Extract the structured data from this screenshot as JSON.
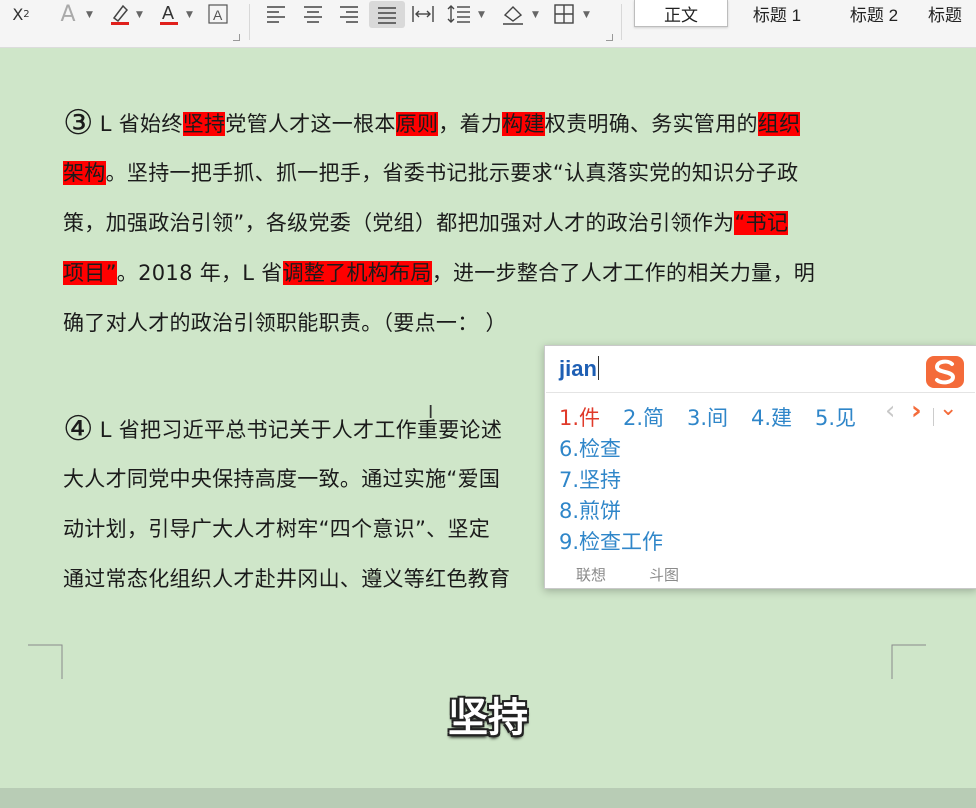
{
  "toolbar": {
    "icons": [
      "subscript-icon",
      "text-effect-icon",
      "highlight-icon",
      "font-color-icon",
      "char-border-icon",
      "align-left-icon",
      "align-center-icon",
      "align-right-icon",
      "justify-icon",
      "distributed-icon",
      "line-spacing-icon",
      "shading-icon",
      "borders-icon"
    ],
    "styles": [
      "正文",
      "标题 1",
      "标题 2",
      "标题"
    ]
  },
  "document": {
    "para3": {
      "marker": "③",
      "lines": [
        [
          {
            "t": "L 省始终"
          },
          {
            "t": "坚持",
            "hl": true
          },
          {
            "t": "党管人才这一根本"
          },
          {
            "t": "原则",
            "hl": true
          },
          {
            "t": "，着力"
          },
          {
            "t": "构建",
            "hl": true
          },
          {
            "t": "权责明确、务实管用的"
          },
          {
            "t": "组织",
            "hl": true
          }
        ],
        [
          {
            "t": "架构",
            "hl": true
          },
          {
            "t": "。坚持一把手抓、抓一把手，省委书记批示要求“认真落实党的知识分子政"
          }
        ],
        [
          {
            "t": "策，加强政治引领”，各级党委（党组）都把加强对人才的政治引领作为"
          },
          {
            "t": "“书记",
            "hl": true
          }
        ],
        [
          {
            "t": "项目”",
            "hl": true
          },
          {
            "t": "。2018 年，L 省"
          },
          {
            "t": "调整了机构布局",
            "hl": true
          },
          {
            "t": "，进一步整合了人才工作的相关力量，明"
          }
        ],
        [
          {
            "t": "确了对人才的政治引领职能职责。（要点一：  ）"
          }
        ]
      ]
    },
    "para4": {
      "marker": "④",
      "lines": [
        [
          {
            "t": "L 省把习近平总书记关于人才工作重要论述"
          }
        ],
        [
          {
            "t": "大人才同党中央保持高度一致。通过实施“爱国"
          }
        ],
        [
          {
            "t": "动计划，引导广大人才树牢“四个意识”、坚定"
          }
        ],
        [
          {
            "t": "通过常态化组织人才赴井冈山、遵义等红色教育"
          }
        ]
      ]
    }
  },
  "ime": {
    "input": "jian",
    "row1": [
      "1.件",
      "2.简",
      "3.间",
      "4.建",
      "5.见"
    ],
    "list": [
      "6.检查",
      "7.坚持",
      "8.煎饼",
      "9.检查工作"
    ],
    "footer": [
      "联想",
      "斗图"
    ],
    "nav": {
      "prev": "‹",
      "next": "›",
      "expand": "⌄"
    }
  },
  "subtitle": "坚持"
}
